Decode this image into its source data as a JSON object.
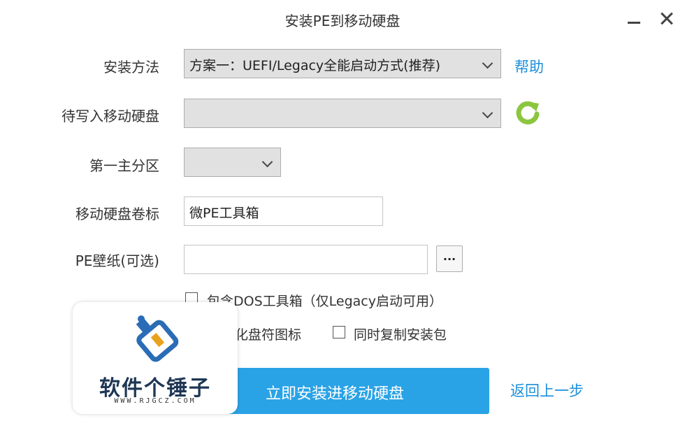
{
  "window": {
    "title": "安装PE到移动硬盘"
  },
  "form": {
    "install_method": {
      "label": "安装方法",
      "value": "方案一：UEFI/Legacy全能启动方式(推荐)"
    },
    "help_link": "帮助",
    "target_disk": {
      "label": "待写入移动硬盘",
      "value": ""
    },
    "primary_partition": {
      "label": "第一主分区",
      "value": ""
    },
    "volume_label": {
      "label": "移动硬盘卷标",
      "value": "微PE工具箱"
    },
    "wallpaper": {
      "label": "PE壁纸(可选)",
      "value": "",
      "browse_label": "..."
    },
    "options": {
      "dos_toolbox": {
        "label": "包含DOS工具箱（仅Legacy启动可用）",
        "checked": false
      },
      "drive_icon": {
        "label": "化盘符图标",
        "checked": false
      },
      "copy_installer": {
        "label": "同时复制安装包",
        "checked": false
      }
    }
  },
  "actions": {
    "install_now": "立即安装进移动硬盘",
    "go_back": "返回上一步"
  },
  "watermark": {
    "name": "软件个锤子",
    "url": "WWW.RJGCZ.COM"
  },
  "colors": {
    "accent": "#2aa3e6",
    "link": "#1b8fdb",
    "refresh_icon": "#8cc63f",
    "watermark_logo": "#2a6cb5",
    "watermark_text": "#1f3755"
  },
  "icons": {
    "refresh": "refresh-icon",
    "minimize": "minimize-icon",
    "close": "close-icon",
    "dropdown": "chevron-down-icon",
    "logo": "hammer-logo-icon"
  }
}
